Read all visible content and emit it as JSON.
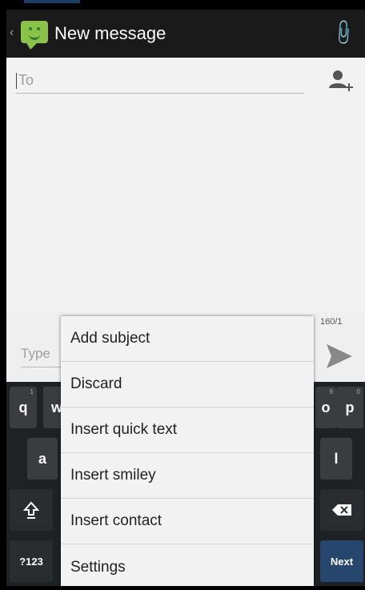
{
  "app": {
    "title": "New message"
  },
  "compose": {
    "to_placeholder": "To",
    "char_counter": "160/1",
    "type_placeholder": "Type"
  },
  "keyboard": {
    "row1_left": [
      "q",
      "w"
    ],
    "row1_left_hints": [
      "1",
      ""
    ],
    "row1_right": [
      "o",
      "p"
    ],
    "row1_right_hints": [
      "9",
      "0"
    ],
    "row2_left": "a",
    "row2_right": "l",
    "numbers_key": "?123",
    "next_key": "Next"
  },
  "menu": {
    "items": [
      "Add subject",
      "Discard",
      "Insert quick text",
      "Insert smiley",
      "Insert contact",
      "Settings"
    ]
  },
  "icons": {
    "back": "chevron-left-icon",
    "app": "messaging-smiley-icon",
    "attach": "paperclip-icon",
    "add_contact": "add-contact-icon",
    "send": "send-icon",
    "shift": "shift-icon",
    "backspace": "backspace-icon"
  },
  "colors": {
    "actionbar": "#1a1a1a",
    "app_icon": "#8bc34a",
    "next_key": "#26466d"
  }
}
